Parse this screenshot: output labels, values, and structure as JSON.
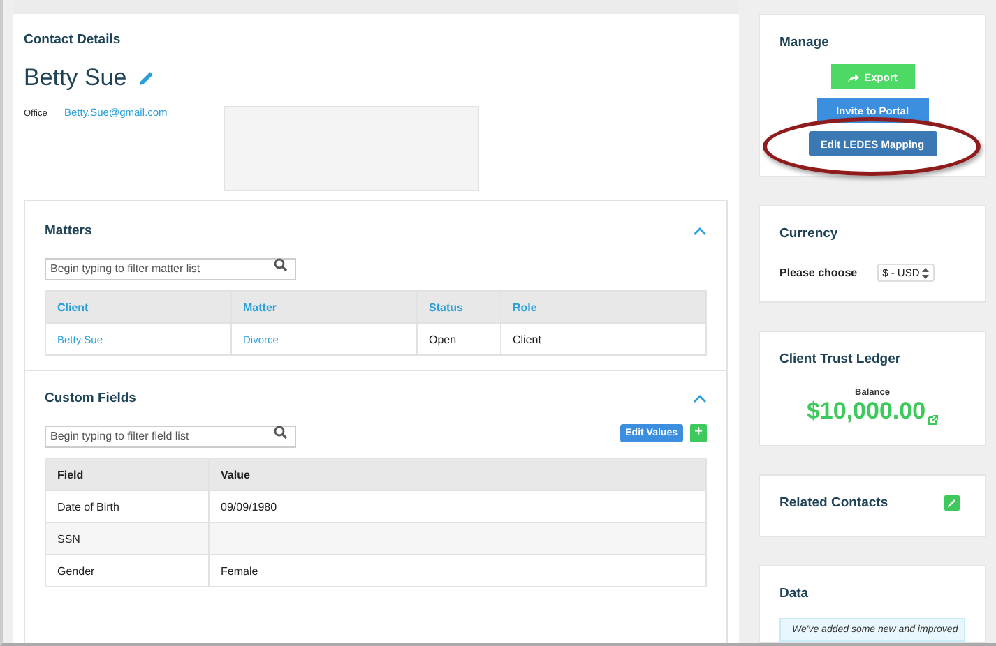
{
  "contact": {
    "section_title": "Contact Details",
    "name": "Betty Sue",
    "email_label": "Office",
    "email": "Betty.Sue@gmail.com"
  },
  "matters": {
    "title": "Matters",
    "expanded": true,
    "filter_placeholder": "Begin typing to filter matter list",
    "columns": [
      "Client",
      "Matter",
      "Status",
      "Role"
    ],
    "rows": [
      {
        "client": "Betty Sue",
        "matter": "Divorce",
        "status": "Open",
        "role": "Client"
      }
    ]
  },
  "custom_fields": {
    "title": "Custom Fields",
    "expanded": true,
    "filter_placeholder": "Begin typing to filter field list",
    "edit_button": "Edit Values",
    "add_button": "+",
    "columns": [
      "Field",
      "Value"
    ],
    "rows": [
      {
        "field": "Date of Birth",
        "value": "09/09/1980"
      },
      {
        "field": "SSN",
        "value": ""
      },
      {
        "field": "Gender",
        "value": "Female"
      }
    ]
  },
  "manage": {
    "title": "Manage",
    "buttons": [
      {
        "label": "Export",
        "kind": "export",
        "highlighted": false
      },
      {
        "label": "Invite to Portal",
        "kind": "invite",
        "highlighted": false
      },
      {
        "label": "Edit LEDES Mapping",
        "kind": "ledes",
        "highlighted": true
      }
    ]
  },
  "currency": {
    "title": "Currency",
    "label": "Please choose",
    "value": "$ - USD"
  },
  "trust_ledger": {
    "title": "Client Trust Ledger",
    "balance_label": "Balance",
    "balance": "$10,000.00"
  },
  "related_contacts": {
    "title": "Related Contacts"
  },
  "data": {
    "title": "Data",
    "notice": "We've added some new and improved"
  }
}
